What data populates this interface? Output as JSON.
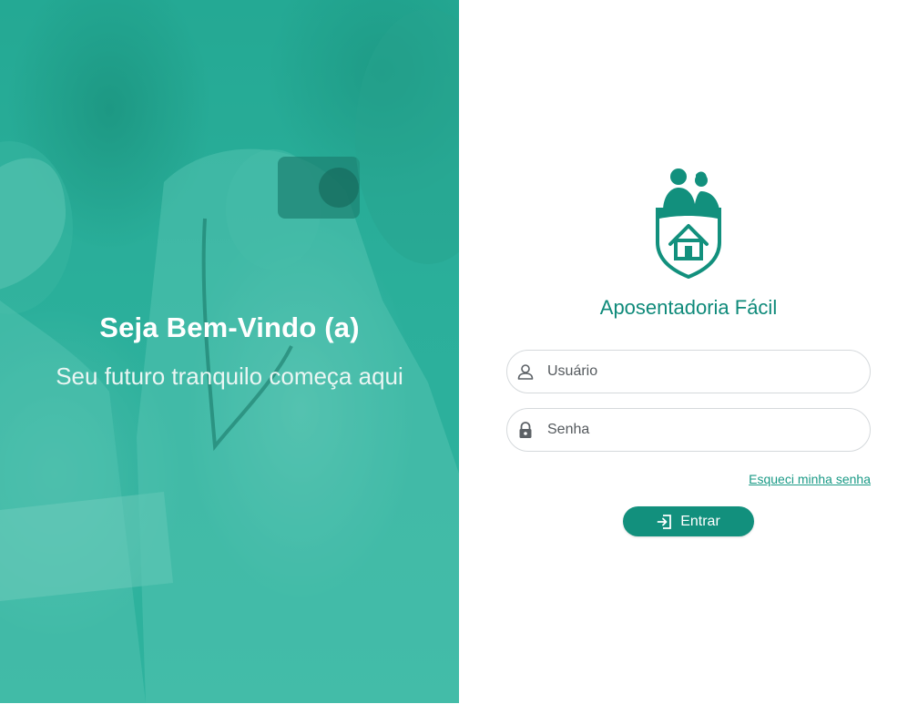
{
  "hero": {
    "title": "Seja Bem-Vindo (a)",
    "subtitle": "Seu futuro tranquilo começa aqui",
    "overlay_color": "#2aa995"
  },
  "brand": {
    "name": "Aposentadoria Fácil",
    "logo_icon": "shield-couple-house-icon",
    "color": "#0f8a7a"
  },
  "login": {
    "username": {
      "placeholder": "Usuário",
      "value": "",
      "icon": "user-icon"
    },
    "password": {
      "placeholder": "Senha",
      "value": "",
      "icon": "lock-icon"
    },
    "forgot_label": "Esqueci minha senha",
    "submit_label": "Entrar",
    "submit_icon": "login-icon",
    "accent": "#12907d"
  }
}
